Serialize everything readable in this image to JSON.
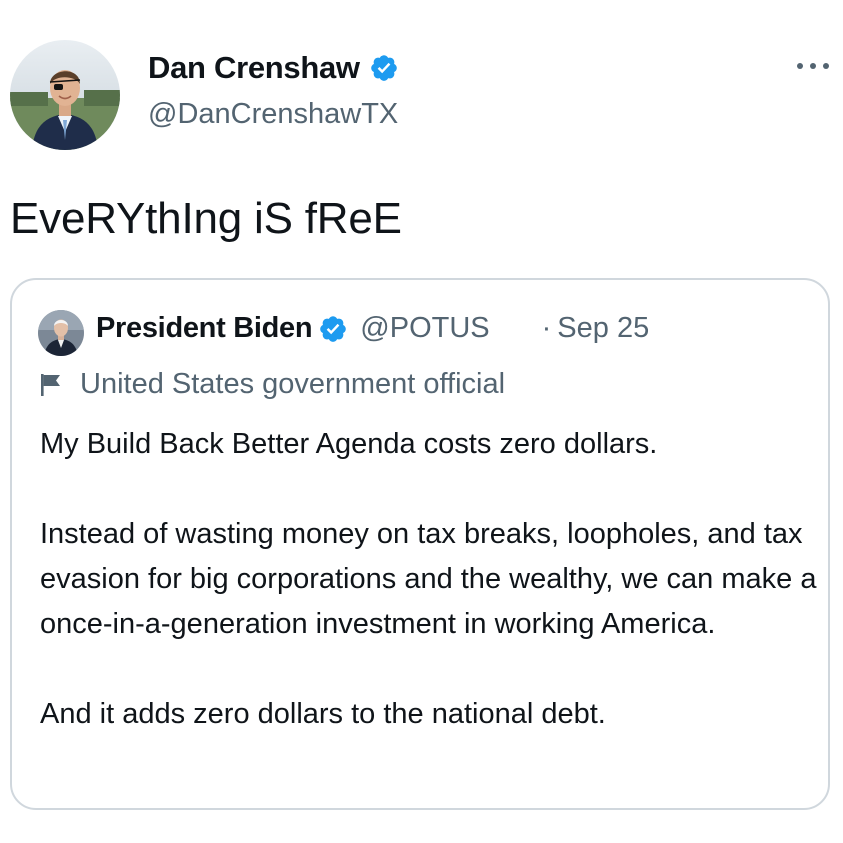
{
  "tweet": {
    "author_name": "Dan Crenshaw",
    "author_handle": "@DanCrenshawTX",
    "verified": true,
    "text": "EveRYthIng iS fReE",
    "more_icon": "more-horizontal-icon"
  },
  "quoted_tweet": {
    "author_name": "President Biden",
    "author_handle": "@POTUS",
    "verified": true,
    "separator": "·",
    "date": "Sep 25",
    "label": "United States government official",
    "label_icon": "flag-icon",
    "paragraphs": [
      "My Build Back Better Agenda costs zero dollars.",
      "Instead of wasting money on tax breaks, loopholes, and tax evasion for big corporations and the wealthy, we can make a once-in-a-generation investment in working America.",
      "And it adds zero dollars to the national debt."
    ]
  },
  "colors": {
    "text_primary": "#0f1419",
    "text_secondary": "#536471",
    "verified_blue": "#1d9bf0",
    "card_border": "#d0d7dd"
  }
}
